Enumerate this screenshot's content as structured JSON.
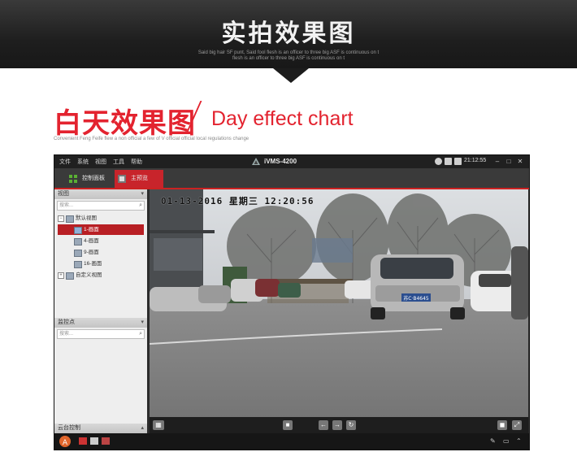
{
  "banner": {
    "title": "实拍效果图",
    "sub1": "Said big hair SF punt, Said fool flesh is an officer to three big ASF is continuous on t",
    "sub2": "flesh is an officer to three big ASF is continuous on t"
  },
  "section": {
    "title_cn": "白天效果图",
    "title_en": "Day effect chart",
    "subtitle": "Convenient Feng Feife flew a non official a few of V official official local regulations change"
  },
  "app": {
    "menu": [
      "文件",
      "系统",
      "视图",
      "工具",
      "帮助"
    ],
    "title": "iVMS-4200",
    "clock": "21:12:55",
    "tabs": [
      {
        "label": "控制面板"
      },
      {
        "label": "主预览"
      }
    ],
    "view_panel": {
      "header": "视图",
      "search_placeholder": "搜索...",
      "tree": [
        {
          "label": "默认视图"
        },
        {
          "label": "1-画面"
        },
        {
          "label": "4-画面"
        },
        {
          "label": "9-画面"
        },
        {
          "label": "16-画面"
        },
        {
          "label": "自定义视图"
        }
      ]
    },
    "camera_panel": {
      "header": "监控点",
      "search_placeholder": "搜索..."
    },
    "ptz_panel": {
      "header": "云台控制"
    },
    "video": {
      "osd": "01-13-2016  星期三  12:20:56",
      "plate": "苏C·B4645"
    },
    "colors": {
      "accent": "#c8242b",
      "brand_red": "#e3232f"
    }
  }
}
